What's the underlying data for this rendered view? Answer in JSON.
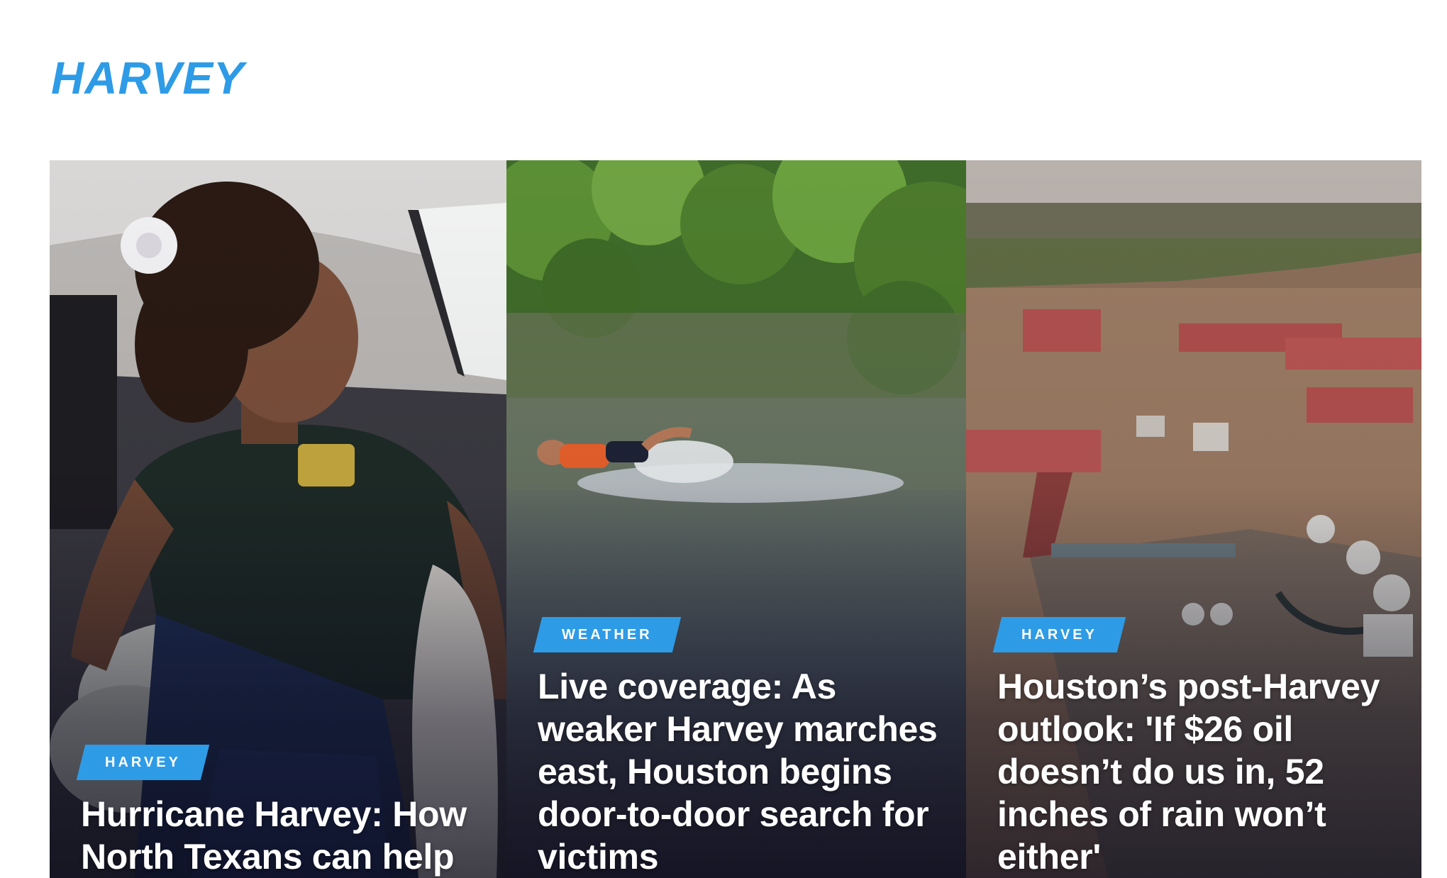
{
  "section": {
    "title": "HARVEY"
  },
  "colors": {
    "accent": "#2e9be6",
    "headline_text": "#ffffff"
  },
  "cards": [
    {
      "tag": "HARVEY",
      "headline": "Hurricane Harvey: How North Texans can help",
      "photo_icon": "volunteer-photo"
    },
    {
      "tag": "WEATHER",
      "headline": "Live coverage: As weaker Harvey marches east, Houston begins door-to-door search for victims",
      "photo_icon": "floodwater-swimmer-photo"
    },
    {
      "tag": "HARVEY",
      "headline": "Houston’s post-Harvey outlook: 'If $26 oil doesn’t do us in, 52 inches of rain won’t either'",
      "photo_icon": "flooded-port-aerial-photo"
    }
  ]
}
